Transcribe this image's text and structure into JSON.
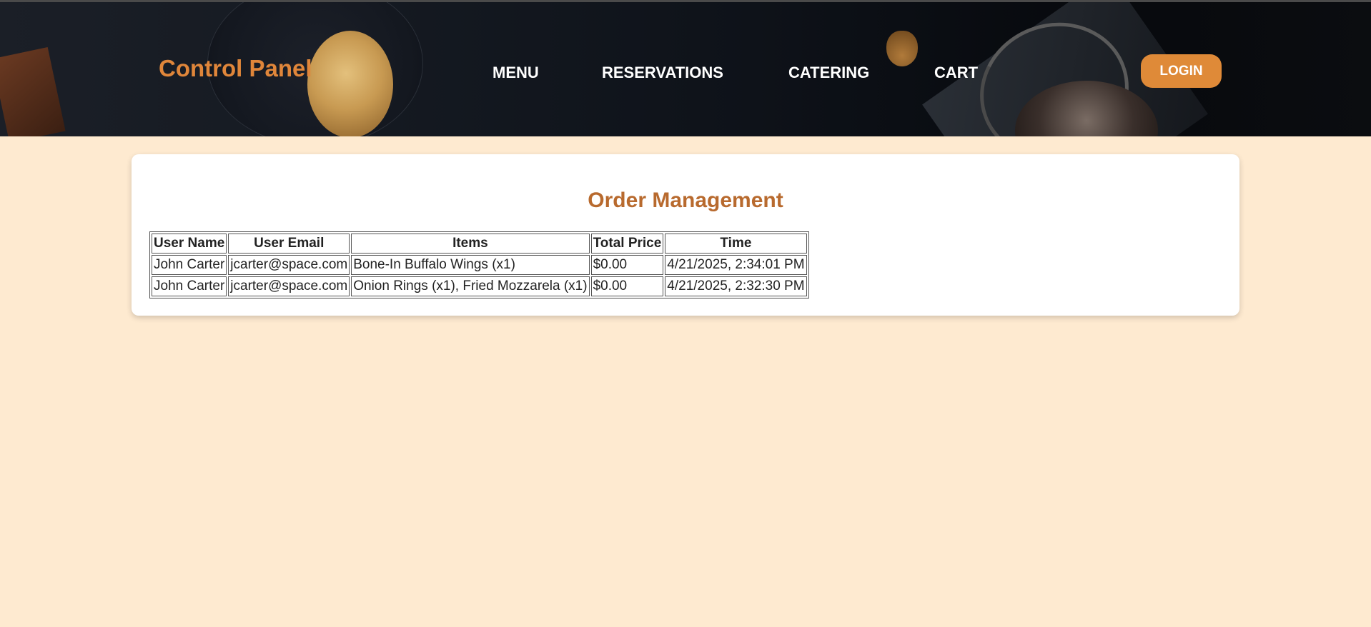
{
  "header": {
    "logo": "Control Panel",
    "nav": [
      {
        "label": "MENU"
      },
      {
        "label": "RESERVATIONS"
      },
      {
        "label": "CATERING"
      },
      {
        "label": "CART"
      }
    ],
    "login_label": "LOGIN"
  },
  "colors": {
    "accent": "#df8a38",
    "title": "#b86a2e",
    "page_bg": "#feead0"
  },
  "main": {
    "title": "Order Management",
    "table": {
      "headers": [
        "User Name",
        "User Email",
        "Items",
        "Total Price",
        "Time"
      ],
      "rows": [
        [
          "John Carter",
          "jcarter@space.com",
          "Bone-In Buffalo Wings (x1)",
          "$0.00",
          "4/21/2025, 2:34:01 PM"
        ],
        [
          "John Carter",
          "jcarter@space.com",
          "Onion Rings (x1), Fried Mozzarela (x1)",
          "$0.00",
          "4/21/2025, 2:32:30 PM"
        ]
      ]
    }
  }
}
